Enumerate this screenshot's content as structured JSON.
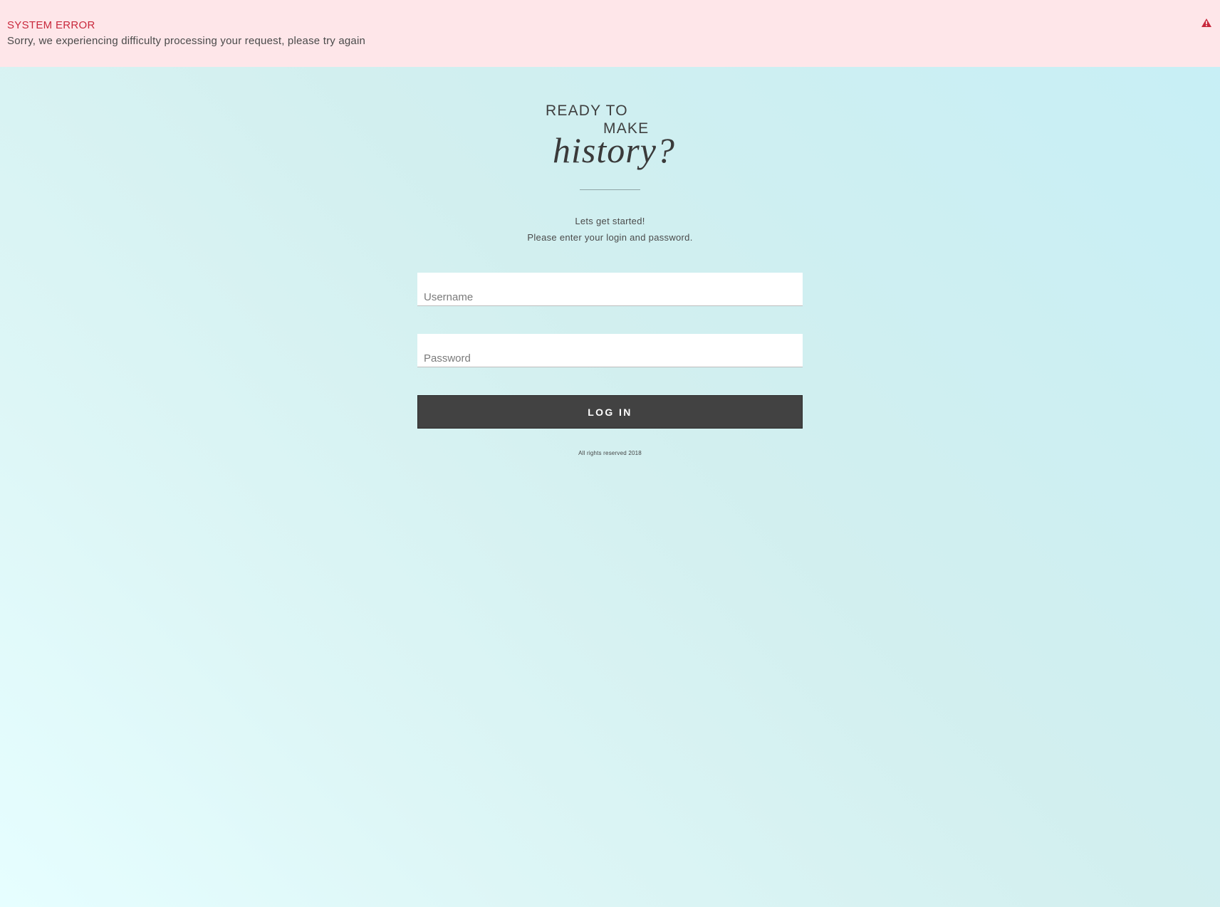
{
  "error": {
    "title": "SYSTEM ERROR",
    "message": "Sorry, we experiencing difficulty processing your request, please try again",
    "icon": "warning-icon",
    "title_color": "#c8283c",
    "background_color": "#fee6e9"
  },
  "hero": {
    "line1": "READY TO",
    "line2": "MAKE",
    "line3": "history?"
  },
  "intro": {
    "line1": "Lets get started!",
    "line2": "Please enter your login and password."
  },
  "form": {
    "username_placeholder": "Username",
    "username_value": "",
    "password_placeholder": "Password",
    "password_value": "",
    "login_label": "LOG IN",
    "button_color": "#424242"
  },
  "footer": {
    "text": "All rights reserved 2018"
  }
}
